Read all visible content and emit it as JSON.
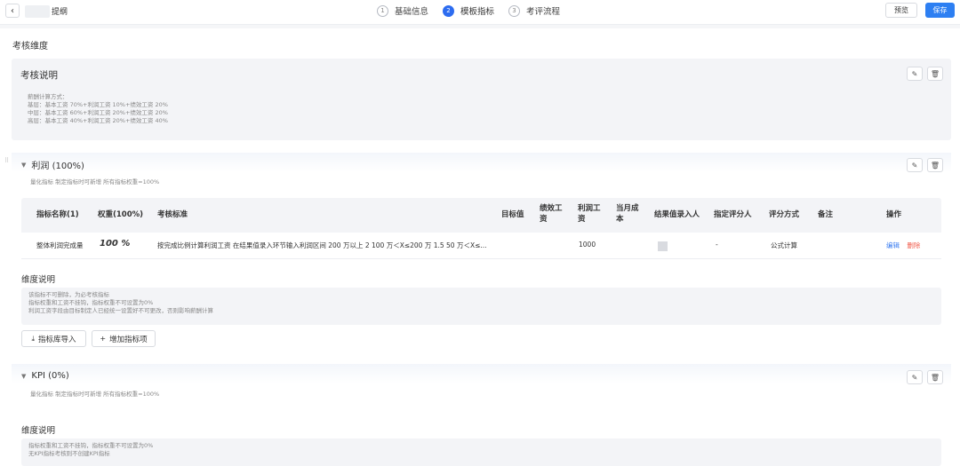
{
  "header": {
    "title": "提纲",
    "steps": [
      {
        "num": "1",
        "label": "基础信息"
      },
      {
        "num": "2",
        "label": "模板指标"
      },
      {
        "num": "3",
        "label": "考评流程"
      }
    ],
    "preview_label": "预览",
    "save_label": "保存"
  },
  "main": {
    "section_title": "考核维度",
    "assessment": {
      "title": "考核说明",
      "lines": [
        "薪酬计算方式：",
        "基层：基本工资 70%+利润工资 10%+绩效工资 20%",
        "中层：基本工资 60%+利润工资 20%+绩效工资 20%",
        "高层：基本工资 40%+利润工资 20%+绩效工资 40%"
      ]
    },
    "profit": {
      "title": "利润 (100%)",
      "meta": "量化指标   制定指标时可新增   所有指标权重=100%",
      "table": {
        "headers": {
          "name": "指标名称(1)",
          "weight": "权重(100%)",
          "standard": "考核标准",
          "target": "目标值",
          "perf_l1": "绩效工",
          "perf_l2": "资",
          "profit_l1": "利润工",
          "profit_l2": "资",
          "cost_l1": "当月成",
          "cost_l2": "本",
          "result_entry": "结果值录入人",
          "evaluator": "指定评分人",
          "method": "评分方式",
          "remark": "备注",
          "ops": "操作"
        },
        "rows": [
          {
            "name": "整体利润完成量",
            "weight": "100 %",
            "standard": "按完成比例计算利润工资 在结果值录入环节输入利润区间 200 万以上 2 100 万＜X≤200 万 1.5 50 万＜X≤...",
            "profit_wage": "1000",
            "evaluator": "-",
            "method": "公式计算",
            "edit": "编辑",
            "delete": "删除"
          }
        ]
      },
      "dim_desc_title": "维度说明",
      "dim_desc_lines": [
        "该指标不可删除，为必考核指标",
        "指标权重和工资不挂钩，指标权重不可设置为0%",
        "利润工资字段由目标制定人已经统一设置好不可更改，否则影响薪酬计算"
      ],
      "import_label": "指标库导入",
      "add_label": "增加指标项"
    },
    "kpi": {
      "title": "KPI (0%)",
      "meta": "量化指标   制定指标时可新增   所有指标权重=100%",
      "dim_desc_title": "维度说明",
      "dim_desc_lines": [
        "指标权重和工资不挂钩，指标权重不可设置为0%",
        "无KPI指标考核则不创建KPI指标"
      ]
    }
  },
  "colors": {
    "primary": "#2d7ff2",
    "danger": "#f05a4a",
    "panel": "#f3f4f7"
  }
}
